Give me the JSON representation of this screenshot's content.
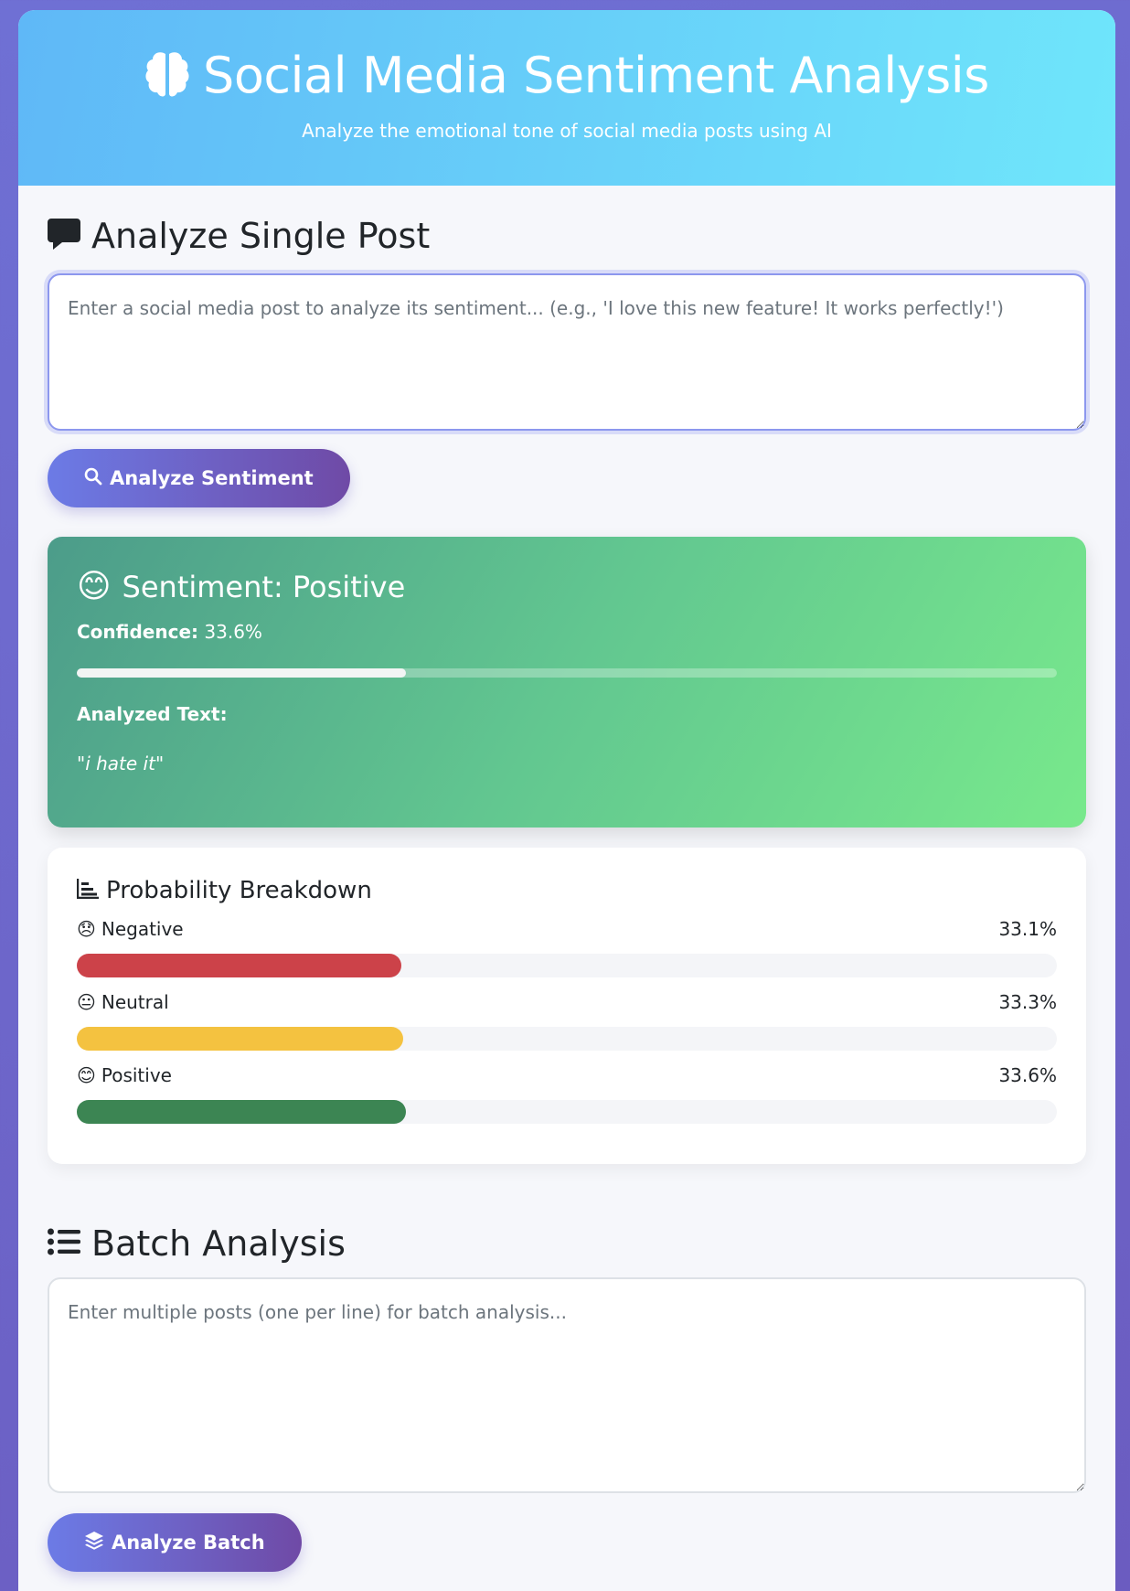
{
  "header": {
    "title": "Social Media Sentiment Analysis",
    "subtitle": "Analyze the emotional tone of social media posts using AI",
    "icon": "brain-icon"
  },
  "single": {
    "heading": "Analyze Single Post",
    "icon": "comment-icon",
    "placeholder": "Enter a social media post to analyze its sentiment... (e.g., 'I love this new feature! It works perfectly!')",
    "button_label": "Analyze Sentiment",
    "button_icon": "search-icon"
  },
  "result": {
    "emoji": "😊",
    "title": "Sentiment: Positive",
    "confidence_label": "Confidence:",
    "confidence_value": "33.6%",
    "confidence_fraction": 0.336,
    "analyzed_label": "Analyzed Text:",
    "analyzed_text": "\"i hate it\""
  },
  "breakdown": {
    "title": "Probability Breakdown",
    "icon": "bar-chart-icon",
    "rows": [
      {
        "emoji": "😞",
        "label": "Negative",
        "value": "33.1%",
        "fraction": 0.331,
        "color": "#cc4249"
      },
      {
        "emoji": "😐",
        "label": "Neutral",
        "value": "33.3%",
        "fraction": 0.333,
        "color": "#f4c240"
      },
      {
        "emoji": "😊",
        "label": "Positive",
        "value": "33.6%",
        "fraction": 0.336,
        "color": "#3c8553"
      }
    ]
  },
  "batch": {
    "heading": "Batch Analysis",
    "icon": "list-icon",
    "placeholder": "Enter multiple posts (one per line) for batch analysis...",
    "button_label": "Analyze Batch",
    "button_icon": "layers-icon"
  }
}
